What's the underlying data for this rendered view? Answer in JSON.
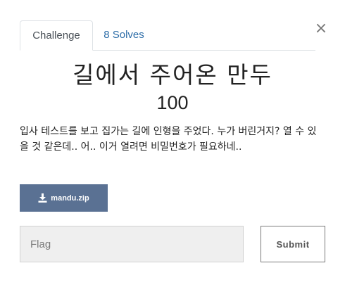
{
  "modal": {
    "close_symbol": "×"
  },
  "tabs": [
    {
      "label": "Challenge",
      "active": true
    },
    {
      "label": "8 Solves",
      "active": false
    }
  ],
  "challenge": {
    "name": "길에서 주어온 만두",
    "points": "100",
    "description": "입사 테스트를 보고 집가는 길에 인형을 주었다. 누가 버린거지? 열 수 있을 것 같은데.. 어.. 이거 열려면 비밀번호가 필요하네..",
    "file": {
      "label": "mandu.zip",
      "icon": "download-icon"
    }
  },
  "submission": {
    "placeholder": "Flag",
    "value": "",
    "submit_label": "Submit"
  },
  "colors": {
    "download_button_bg": "#5a7193",
    "tab_link": "#2d6da8",
    "input_bg": "#efefef"
  }
}
